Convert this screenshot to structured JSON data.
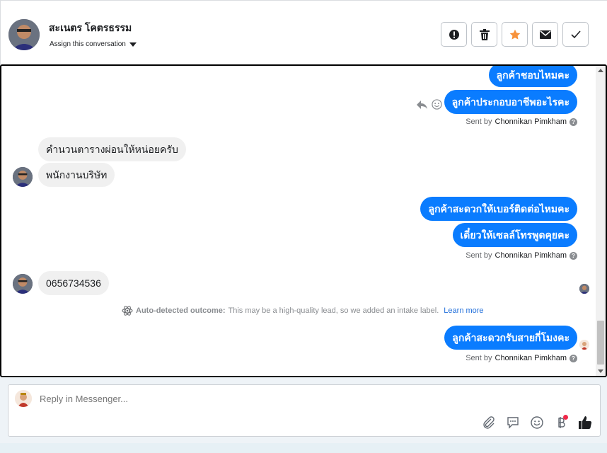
{
  "header": {
    "name": "สะเนตร โคตรธรรม",
    "assign_label": "Assign this conversation",
    "actions": [
      {
        "icon": "alert-icon",
        "label": "Mark as spam"
      },
      {
        "icon": "trash-icon",
        "label": "Delete"
      },
      {
        "icon": "star-icon",
        "label": "Star"
      },
      {
        "icon": "mail-icon",
        "label": "Mark as unread"
      },
      {
        "icon": "check-icon",
        "label": "Mark as done"
      }
    ],
    "star_color": "#f7923b"
  },
  "messages": {
    "m1": "ลูกค้าชอบไหมคะ",
    "m2": "ลูกค้าประกอบอาชีพอะไรคะ",
    "m3": "คำนวนตารางผ่อนให้หน่อยครับ",
    "m4": "พนักงานบริษัท",
    "m5": "ลูกค้าสะดวกให้เบอร์ติดต่อไหมคะ",
    "m6": "เดี๋ยวให้เซลล์โทรพูดคุยคะ",
    "m7": "0656734536",
    "m8": "ลูกค้าสะดวกรับสายกี่โมงคะ"
  },
  "sent_by": {
    "prefix": "Sent by",
    "name": "Chonnikan Pimkham",
    "help": "?"
  },
  "outcome": {
    "icon": "atom-icon",
    "label": "Auto-detected outcome:",
    "text": "This may be a high-quality lead, so we added an intake label.",
    "link": "Learn more"
  },
  "reply": {
    "placeholder": "Reply in Messenger...",
    "tools": [
      "paperclip-icon",
      "message-icon",
      "emoji-icon",
      "baht-icon",
      "thumbs-up-icon"
    ]
  },
  "colors": {
    "outgoing_bubble": "#0a7cff",
    "incoming_bubble": "#f0f0f0",
    "link": "#216fdb"
  }
}
